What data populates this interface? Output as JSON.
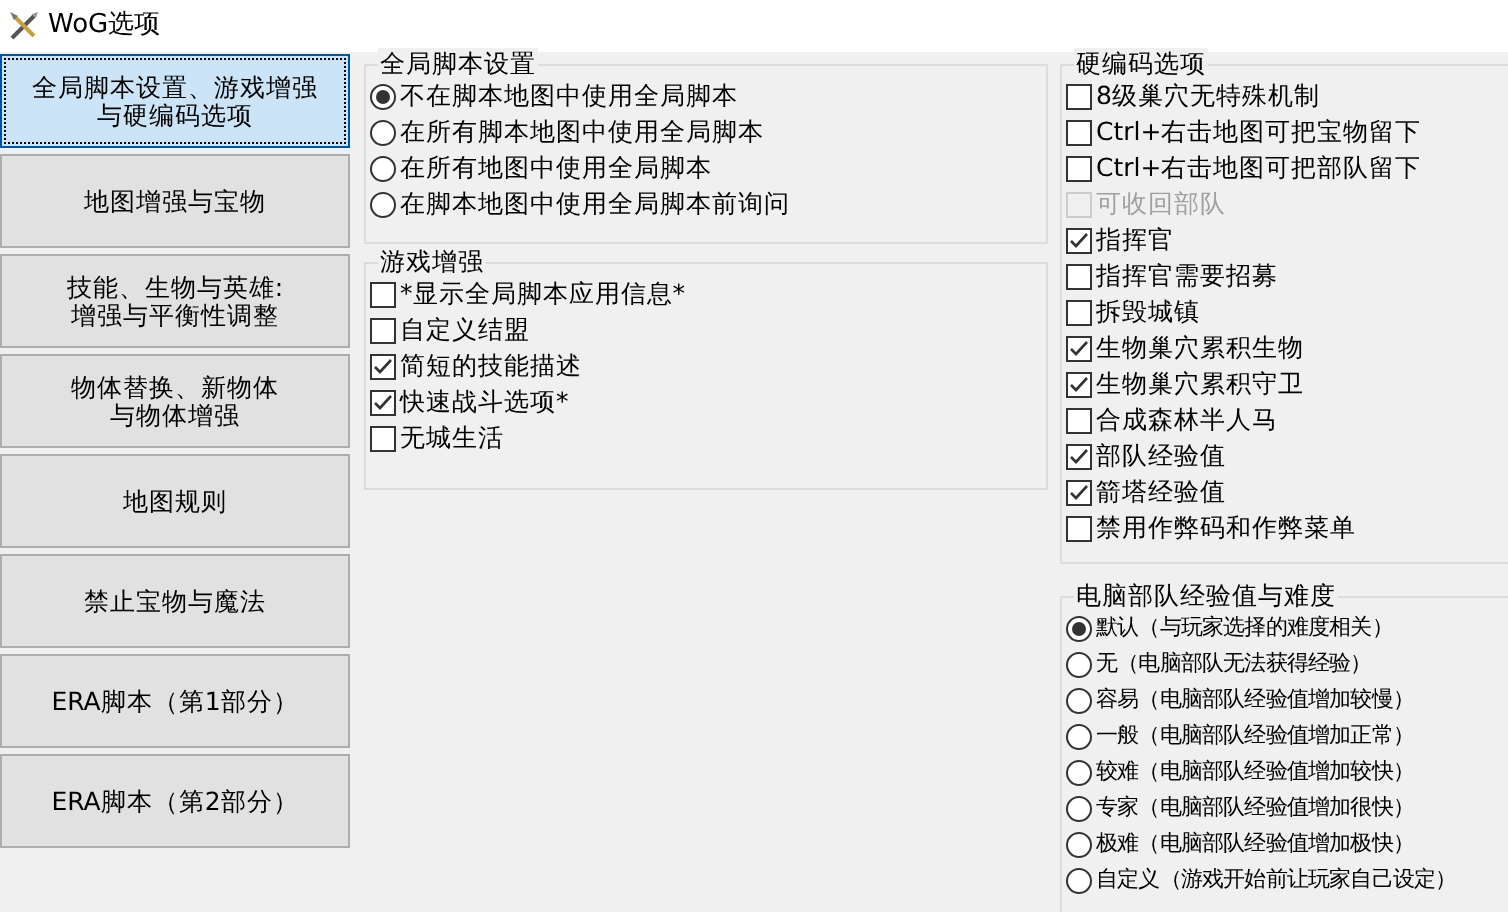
{
  "window": {
    "title": "WoG选项"
  },
  "sidebar": {
    "items": [
      {
        "lines": [
          "全局脚本设置、游戏增强",
          "与硬编码选项"
        ],
        "selected": true
      },
      {
        "lines": [
          "地图增强与宝物"
        ],
        "selected": false
      },
      {
        "lines": [
          "技能、生物与英雄:",
          "增强与平衡性调整"
        ],
        "selected": false
      },
      {
        "lines": [
          "物体替换、新物体",
          "与物体增强"
        ],
        "selected": false
      },
      {
        "lines": [
          "地图规则"
        ],
        "selected": false
      },
      {
        "lines": [
          "禁止宝物与魔法"
        ],
        "selected": false
      },
      {
        "lines": [
          "ERA脚本（第1部分）"
        ],
        "selected": false
      },
      {
        "lines": [
          "ERA脚本（第2部分）"
        ],
        "selected": false
      }
    ]
  },
  "global_script_settings": {
    "title": "全局脚本设置",
    "options": [
      {
        "label": "不在脚本地图中使用全局脚本",
        "selected": true
      },
      {
        "label": "在所有脚本地图中使用全局脚本",
        "selected": false
      },
      {
        "label": "在所有地图中使用全局脚本",
        "selected": false
      },
      {
        "label": "在脚本地图中使用全局脚本前询问",
        "selected": false
      }
    ]
  },
  "game_enhancements": {
    "title": "游戏增强",
    "options": [
      {
        "label": "*显示全局脚本应用信息*",
        "checked": false
      },
      {
        "label": "自定义结盟",
        "checked": false
      },
      {
        "label": "简短的技能描述",
        "checked": true
      },
      {
        "label": "快速战斗选项*",
        "checked": true
      },
      {
        "label": "无城生活",
        "checked": false
      }
    ]
  },
  "hardcoded_options": {
    "title": "硬编码选项",
    "options": [
      {
        "label": "8级巢穴无特殊机制",
        "checked": false,
        "disabled": false
      },
      {
        "label": "Ctrl+右击地图可把宝物留下",
        "checked": false,
        "disabled": false
      },
      {
        "label": "Ctrl+右击地图可把部队留下",
        "checked": false,
        "disabled": false
      },
      {
        "label": "可收回部队",
        "checked": false,
        "disabled": true
      },
      {
        "label": "指挥官",
        "checked": true,
        "disabled": false
      },
      {
        "label": "指挥官需要招募",
        "checked": false,
        "disabled": false
      },
      {
        "label": "拆毁城镇",
        "checked": false,
        "disabled": false
      },
      {
        "label": "生物巢穴累积生物",
        "checked": true,
        "disabled": false
      },
      {
        "label": "生物巢穴累积守卫",
        "checked": true,
        "disabled": false
      },
      {
        "label": "合成森林半人马",
        "checked": false,
        "disabled": false
      },
      {
        "label": "部队经验值",
        "checked": true,
        "disabled": false
      },
      {
        "label": "箭塔经验值",
        "checked": true,
        "disabled": false
      },
      {
        "label": "禁用作弊码和作弊菜单",
        "checked": false,
        "disabled": false
      }
    ]
  },
  "ai_experience": {
    "title": "电脑部队经验值与难度",
    "options": [
      {
        "label": "默认（与玩家选择的难度相关）",
        "selected": true
      },
      {
        "label": "无（电脑部队无法获得经验）",
        "selected": false
      },
      {
        "label": "容易（电脑部队经验值增加较慢）",
        "selected": false
      },
      {
        "label": "一般（电脑部队经验值增加正常）",
        "selected": false
      },
      {
        "label": "较难（电脑部队经验值增加较快）",
        "selected": false
      },
      {
        "label": "专家（电脑部队经验值增加很快）",
        "selected": false
      },
      {
        "label": "极难（电脑部队经验值增加极快）",
        "selected": false
      },
      {
        "label": "自定义（游戏开始前让玩家自己设定）",
        "selected": false
      }
    ]
  }
}
